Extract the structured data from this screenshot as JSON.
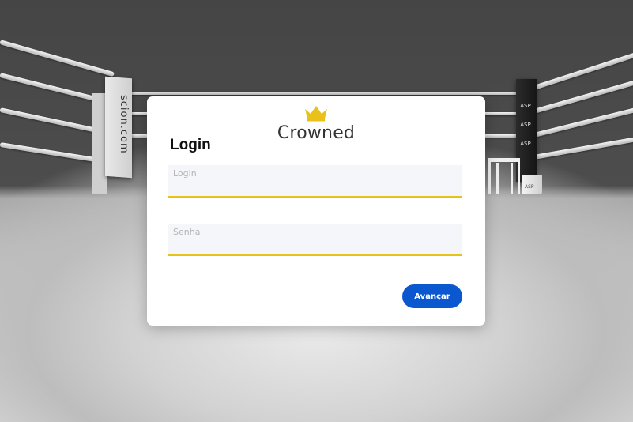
{
  "brand": {
    "name": "Crowned",
    "crown_color": "#e8c21a"
  },
  "background": {
    "post_left_text": "scion.com",
    "post_right_labels": [
      "ASP",
      "ASP",
      "ASP"
    ],
    "bucket_text": "ASP"
  },
  "form": {
    "title": "Login",
    "login_field": {
      "label": "Login",
      "value": ""
    },
    "password_field": {
      "label": "Senha",
      "value": ""
    },
    "submit_label": "Avançar",
    "accent_color": "#e6c21a",
    "button_color": "#0a57cf"
  }
}
